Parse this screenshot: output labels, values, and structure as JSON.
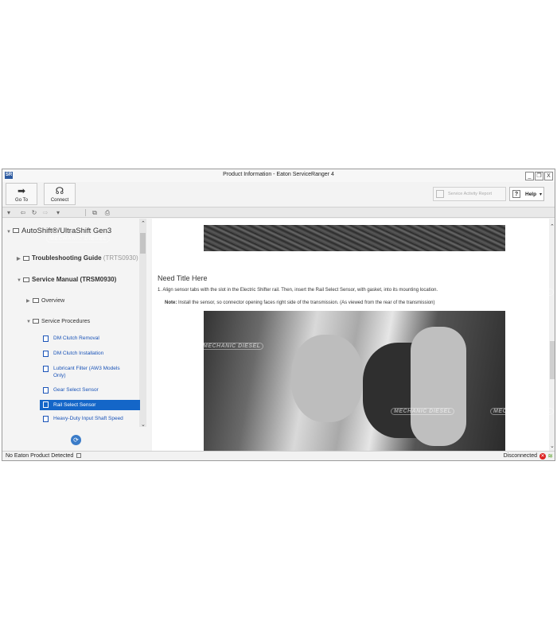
{
  "window": {
    "title": "Product Information - Eaton ServiceRanger 4",
    "app_icon_text": "SR",
    "controls": {
      "minimize": "_",
      "restore": "❐",
      "close": "X"
    }
  },
  "ribbon": {
    "goto_label": "Go To",
    "connect_label": "Connect",
    "service_activity_label": "Service Activity Report",
    "help_label": "Help"
  },
  "toolbar": {
    "icons": [
      "dropdown-icon",
      "back-icon",
      "refresh-icon",
      "forward-icon",
      "dropdown-icon",
      "open-external-icon",
      "print-icon"
    ]
  },
  "sidebar": {
    "root_label": "AutoShift®/UltraShift Gen3",
    "troubleshooting_label": "Troubleshooting Guide",
    "troubleshooting_code": "(TRTS0930)",
    "service_manual_label": "Service Manual (TRSM0930)",
    "overview_label": "Overview",
    "service_procedures_label": "Service Procedures",
    "docs": [
      "DM Clutch Removal",
      "DM Clutch Installation",
      "Lubricant Filter (AW3 Models Only)",
      "Gear Select Sensor",
      "Rail Select Sensor",
      "Heavy-Duty Input Shaft Speed"
    ]
  },
  "content": {
    "heading": "Need Title Here",
    "step1": "1.  Align sensor tabs with the slot in the Electric Shifter rail. Then, insert the Rail Select Sensor, with gasket, into its mounting location.",
    "note_label": "Note:",
    "note_text": " Install the sensor, so connector opening faces right side of the transmission. (As viewed from the rear of the transmission)"
  },
  "watermark": "MECHANIC DIESEL",
  "status": {
    "left": "No Eaton Product Detected",
    "right": "Disconnected"
  },
  "colors": {
    "selected_bg": "#1466c8",
    "link": "#1a54b8",
    "error": "#dd2222",
    "wifi": "#5aa02c"
  }
}
